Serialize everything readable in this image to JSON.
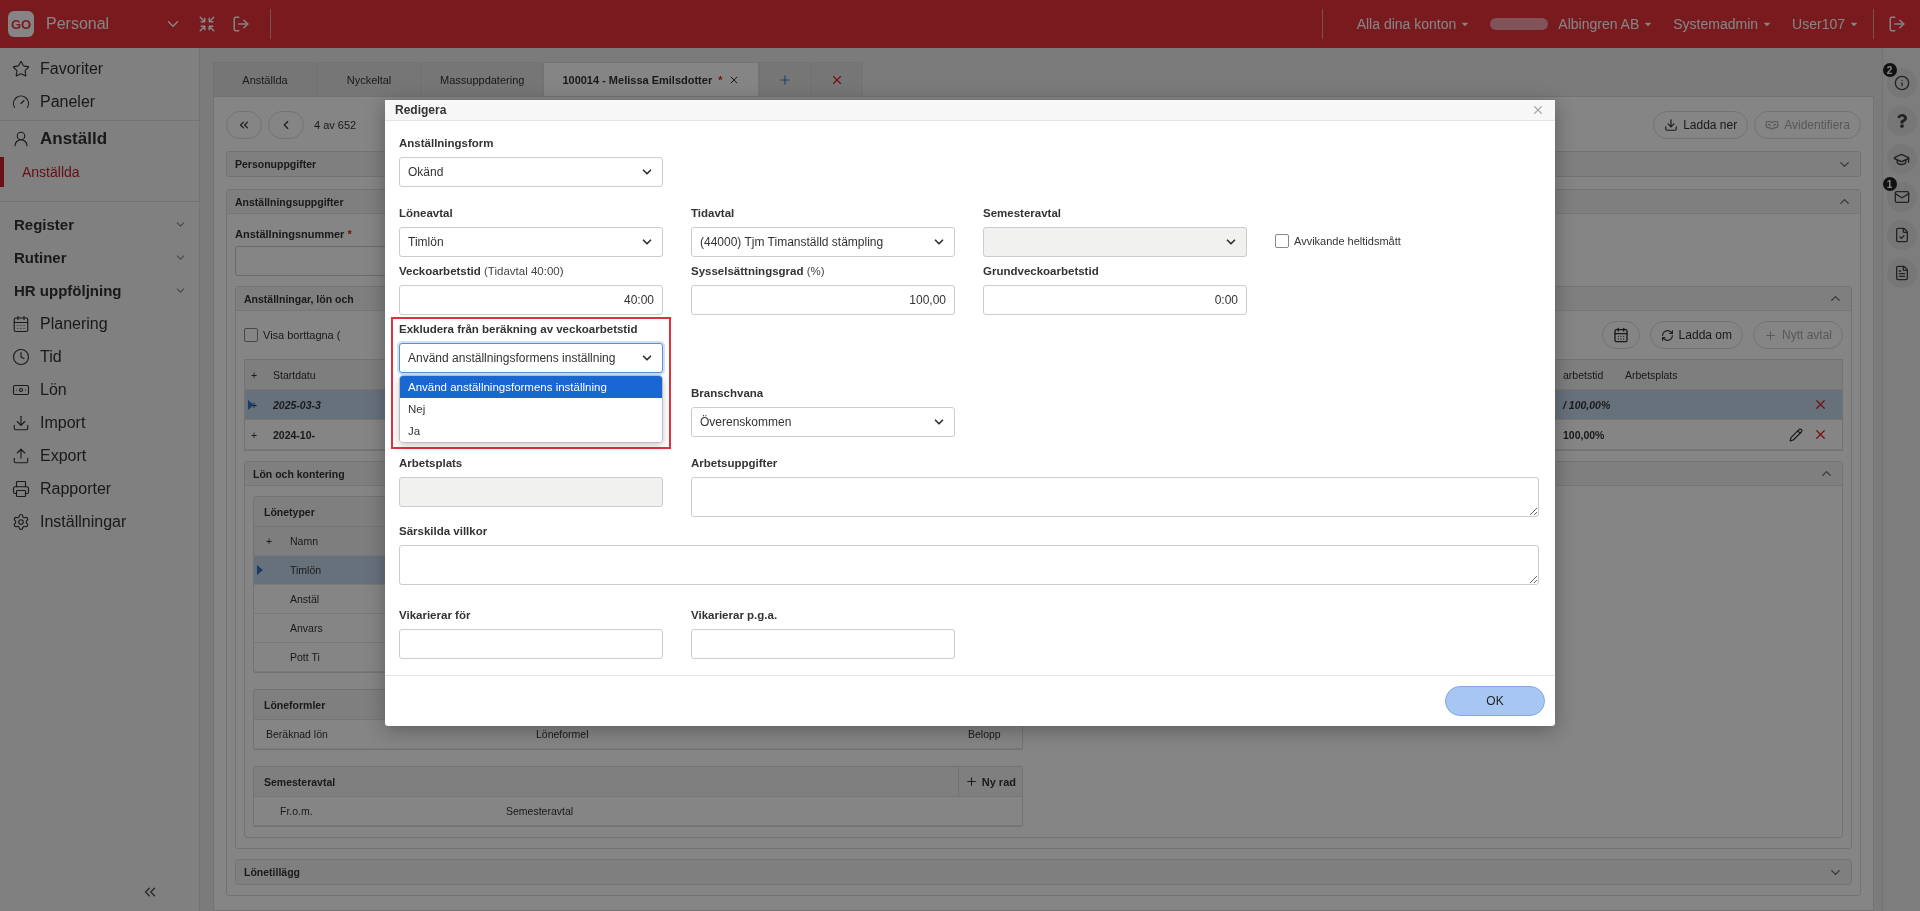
{
  "topbar": {
    "logo": "GO",
    "module": "Personal",
    "menus": [
      {
        "label": "Alla dina konton",
        "kind": "plain"
      },
      {
        "label": "Albingren AB",
        "kind": "redacted"
      },
      {
        "label": "Systemadmin",
        "kind": "plain"
      },
      {
        "label": "User107",
        "kind": "plain"
      }
    ]
  },
  "sidebar": {
    "items": [
      {
        "label": "Favoriter",
        "kind": "link"
      },
      {
        "label": "Paneler",
        "kind": "link"
      },
      {
        "label": "Anställd",
        "kind": "section",
        "children": [
          {
            "label": "Anställda",
            "selected": true
          }
        ]
      },
      {
        "label": "Register",
        "kind": "group",
        "expanded": false
      },
      {
        "label": "Rutiner",
        "kind": "group",
        "expanded": false
      },
      {
        "label": "HR uppföljning",
        "kind": "group",
        "expanded": false
      },
      {
        "label": "Planering",
        "kind": "link"
      },
      {
        "label": "Tid",
        "kind": "link"
      },
      {
        "label": "Lön",
        "kind": "link"
      },
      {
        "label": "Import",
        "kind": "link"
      },
      {
        "label": "Export",
        "kind": "link"
      },
      {
        "label": "Rapporter",
        "kind": "link"
      },
      {
        "label": "Inställningar",
        "kind": "link"
      }
    ]
  },
  "tabs": [
    {
      "label": "Anställda",
      "kind": "text",
      "selected": false
    },
    {
      "label": "Nyckeltal",
      "kind": "text",
      "selected": false
    },
    {
      "label": "Massuppdatering",
      "kind": "text",
      "selected": false
    },
    {
      "label": "100014 - Melissa Emilsdotter",
      "marker": "*",
      "kind": "closable",
      "selected": true
    },
    {
      "kind": "add",
      "selected": false
    },
    {
      "kind": "close-all",
      "selected": false
    }
  ],
  "record_nav": {
    "position": "4 av 652"
  },
  "actions": [
    {
      "label": "Ladda ner",
      "kind": "download",
      "disabled": false
    },
    {
      "label": "Avidentifiera",
      "kind": "anonymize",
      "disabled": true
    }
  ],
  "personuppgifter": {
    "title": "Personuppgifter",
    "expanded": false
  },
  "anstallningsuppgifter": {
    "title": "Anställningsuppgifter",
    "expanded": true,
    "field_label": "Anställningsnummer",
    "required_mark": "*"
  },
  "anstallningar": {
    "title": "Anställningar, lön och",
    "expanded": true,
    "show_deleted": {
      "label": "Visa borttagna (",
      "checked": false
    },
    "buttons": [
      {
        "label": "Ladda om",
        "kind": "reload",
        "disabled": false
      },
      {
        "label": "Nytt avtal",
        "kind": "add",
        "disabled": true
      }
    ],
    "columns_left": [
      "+",
      "Startdatu"
    ],
    "columns_right": [
      "arbetstid",
      "Arbetsplats"
    ],
    "rows": [
      {
        "add": "+",
        "start": "2025-03-3",
        "percent": "/ 100,00%",
        "selected": true,
        "italic": true,
        "editable": false
      },
      {
        "add": "+",
        "start": "2024-10-",
        "percent": "100,00%",
        "selected": false,
        "italic": false,
        "editable": true
      }
    ]
  },
  "lon_och_kontering": {
    "title": "Lön och kontering",
    "expanded": true,
    "lonetyper": {
      "title": "Lönetyper",
      "columns": [
        "+",
        "Namn"
      ],
      "rows": [
        {
          "name": "Timlön",
          "selected": true
        },
        {
          "name": "Anstäl",
          "selected": false
        },
        {
          "name": "Anvars",
          "selected": false
        },
        {
          "name": "Pott Ti",
          "selected": false
        }
      ]
    },
    "loneformler": {
      "title": "Löneformler",
      "columns": [
        "Beräknad lön",
        "Löneformel",
        "Belopp"
      ]
    },
    "semesteravtal": {
      "title": "Semesteravtal",
      "add_label": "Ny rad",
      "columns": [
        "Fr.o.m.",
        "Semesteravtal"
      ]
    }
  },
  "lonetillagg": {
    "title": "Lönetillägg",
    "expanded": false
  },
  "right_rail": [
    {
      "kind": "info",
      "badge": "2"
    },
    {
      "kind": "help"
    },
    {
      "kind": "education"
    },
    {
      "kind": "mail",
      "badge": "1"
    },
    {
      "kind": "file-check"
    },
    {
      "kind": "document"
    }
  ],
  "modal": {
    "title": "Redigera",
    "ok": "OK",
    "rows": [
      [
        {
          "kind": "select",
          "label": "Anställningsform",
          "value": "Okänd"
        }
      ],
      [
        {
          "kind": "select",
          "label": "Löneavtal",
          "value": "Timlön"
        },
        {
          "kind": "select",
          "label": "Tidavtal",
          "value": "(44000) Tjm Timanställd stämpling"
        },
        {
          "kind": "select",
          "label": "Semesteravtal",
          "disabled": true
        },
        {
          "kind": "checkbox",
          "label": "Avvikande heltidsmått",
          "checked": false
        }
      ],
      [
        {
          "kind": "input",
          "label": "Veckoarbetstid",
          "hint": "(Tidavtal 40:00)",
          "value": "40:00"
        },
        {
          "kind": "input",
          "label": "Sysselsättningsgrad",
          "hint": "(%)",
          "value": "100,00"
        },
        {
          "kind": "input",
          "label": "Grundveckoarbetstid",
          "value": "0:00"
        }
      ],
      [
        {
          "kind": "dropdown",
          "label": "Exkludera från beräkning av veckoarbetstid",
          "value": "Använd anställningsformens inställning",
          "highlighted": true,
          "options": [
            {
              "label": "Använd anställningsformens inställning",
              "selected": true
            },
            {
              "label": "Nej",
              "selected": false
            },
            {
              "label": "Ja",
              "selected": false
            }
          ]
        },
        {
          "kind": "select",
          "label": "Branschvana",
          "value": "Överenskommen"
        }
      ],
      [
        {
          "kind": "input",
          "label": "Arbetsplats",
          "disabled": true
        },
        {
          "kind": "textarea",
          "label": "Arbetsuppgifter"
        }
      ],
      [
        {
          "kind": "textarea",
          "label": "Särskilda villkor"
        }
      ],
      [
        {
          "kind": "input",
          "label": "Vikarierar för"
        },
        {
          "kind": "input",
          "label": "Vikarierar p.g.a."
        }
      ]
    ]
  }
}
